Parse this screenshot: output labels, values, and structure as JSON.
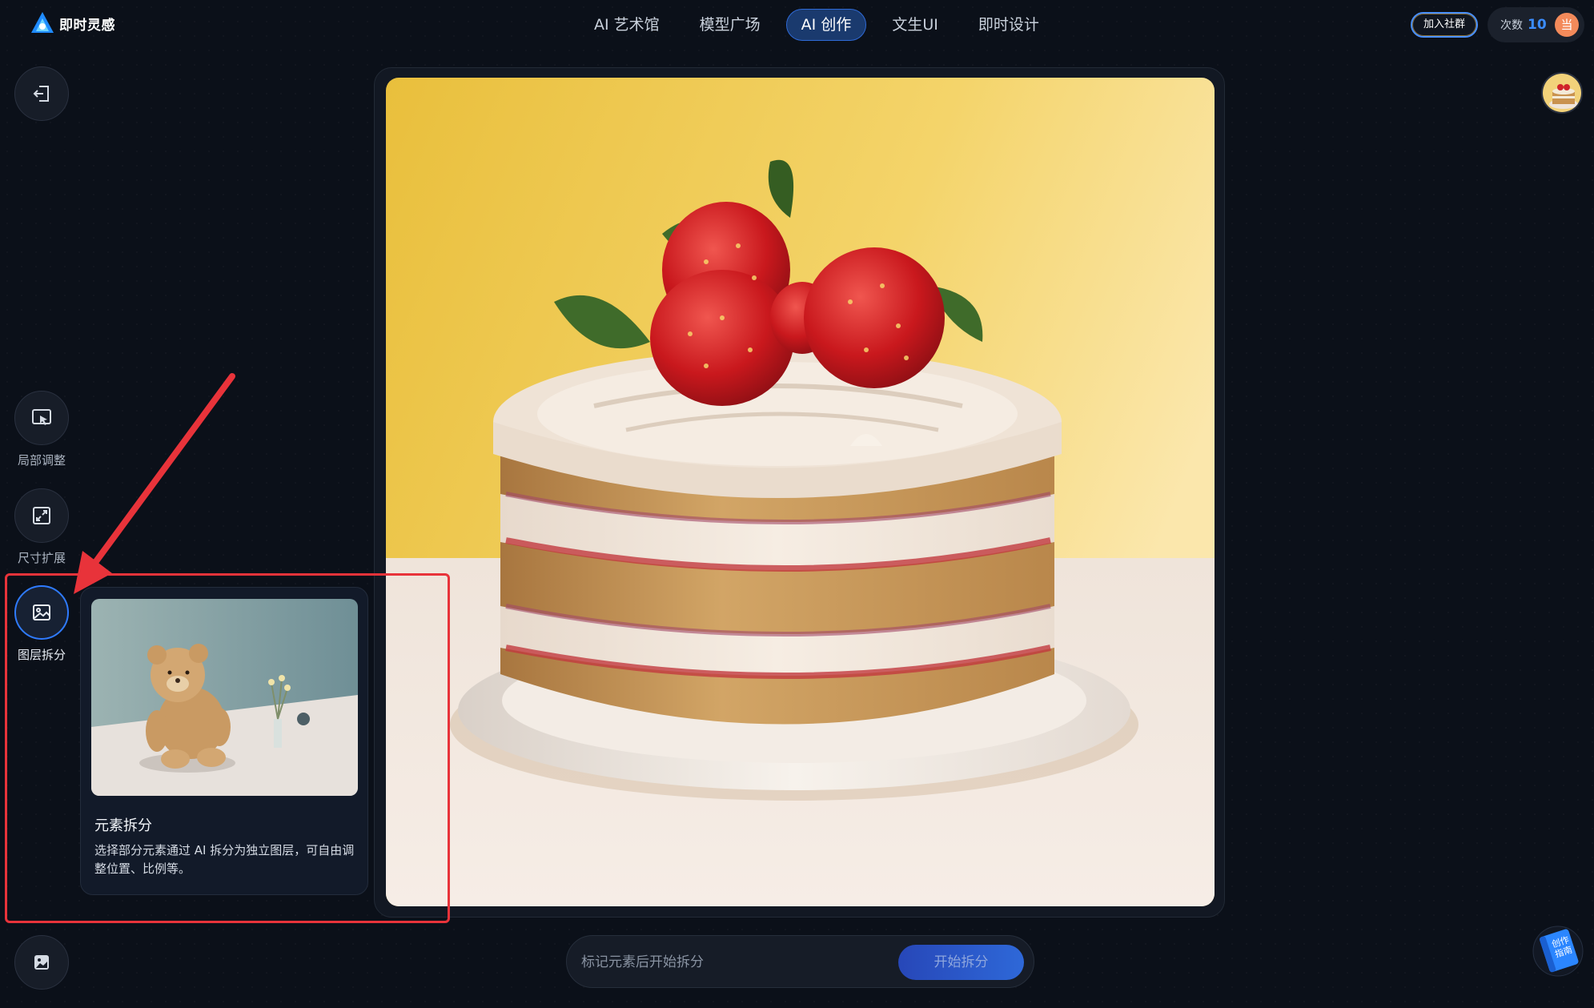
{
  "brand": {
    "name": "即时灵感"
  },
  "nav": {
    "items": [
      {
        "label": "AI 艺术馆"
      },
      {
        "label": "模型广场"
      },
      {
        "label": "AI 创作"
      },
      {
        "label": "文生UI"
      },
      {
        "label": "即时设计"
      }
    ],
    "active_index": 2
  },
  "header": {
    "join_label": "加入社群",
    "quota_label": "次数",
    "quota_value": "10",
    "user_initial": "当"
  },
  "tools": {
    "local_adjust": "局部调整",
    "size_expand": "尺寸扩展",
    "layer_split": "图层拆分"
  },
  "popup": {
    "title": "元素拆分",
    "description": "选择部分元素通过 AI 拆分为独立图层，可自由调整位置、比例等。"
  },
  "split_bar": {
    "placeholder": "标记元素后开始拆分",
    "button_label": "开始拆分"
  },
  "guide": {
    "line1": "创作",
    "line2": "指南"
  },
  "colors": {
    "accent": "#2f7bff",
    "annotation": "#e8333a",
    "background": "#0b1019"
  },
  "icons": [
    "logo-icon",
    "exit-icon",
    "local-adjust-icon",
    "size-expand-icon",
    "layer-split-icon",
    "image-icon",
    "guide-book-icon"
  ]
}
